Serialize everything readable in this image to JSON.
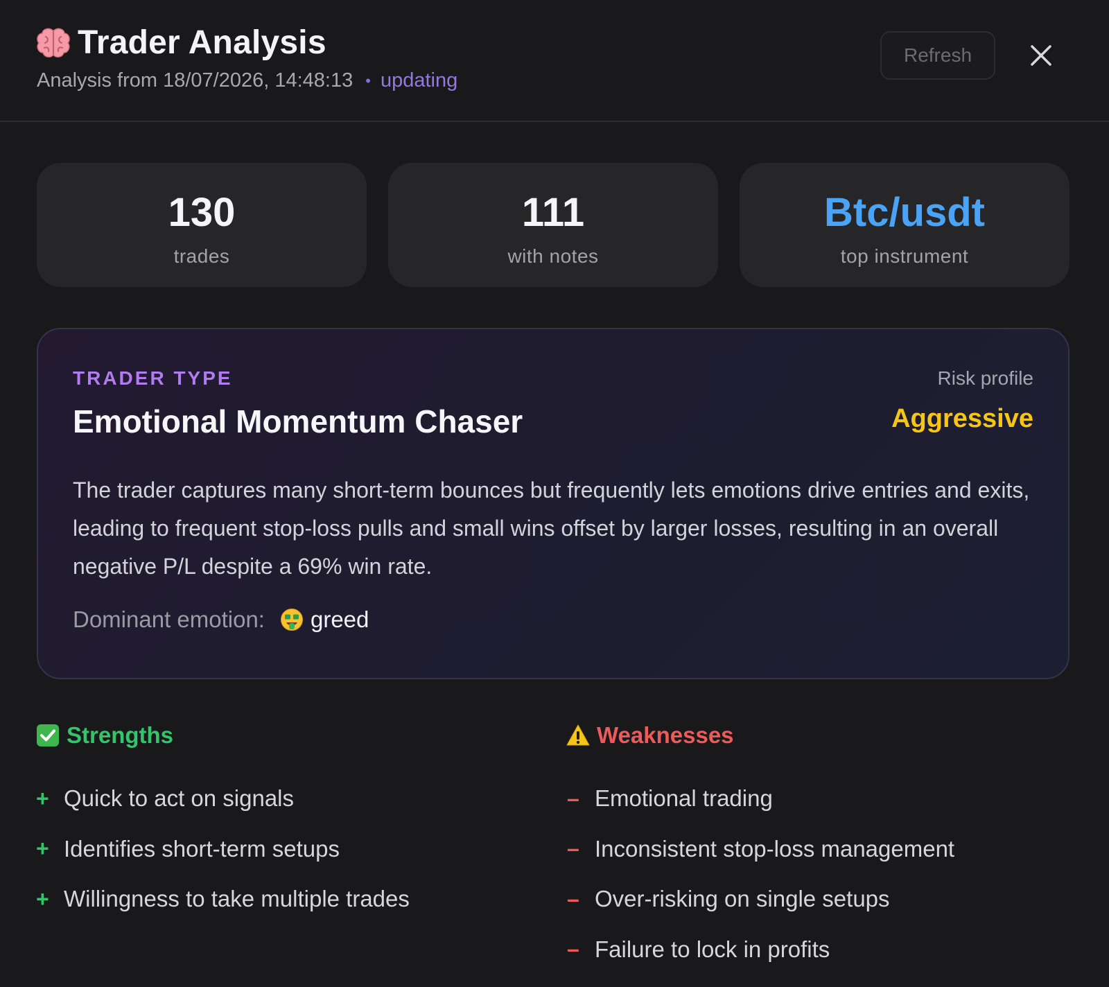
{
  "header": {
    "title": "Trader Analysis",
    "title_icon": "brain-icon",
    "subtitle": "Analysis from 18/07/2026, 14:48:13",
    "dot": "•",
    "status": "updating",
    "refresh_label": "Refresh",
    "close_icon": "close-icon"
  },
  "stats": [
    {
      "value": "130",
      "label": "trades"
    },
    {
      "value": "111",
      "label": "with notes"
    },
    {
      "value": "Btc/usdt",
      "label": "top instrument"
    }
  ],
  "trader_type": {
    "label": "TRADER TYPE",
    "name": "Emotional Momentum Chaser",
    "risk_label": "Risk profile",
    "risk_value": "Aggressive",
    "description": "The trader captures many short-term bounces but frequently lets emotions drive entries and exits, leading to frequent stop-loss pulls and small wins offset by larger losses, resulting in an overall negative P/L despite a 69% win rate.",
    "emotion_label": "Dominant emotion:",
    "emotion_icon": "money-face-icon",
    "emotion_value": "greed"
  },
  "strengths": {
    "title": "Strengths",
    "icon": "check-box-icon",
    "marker": "+",
    "items": [
      "Quick to act on signals",
      "Identifies short-term setups",
      "Willingness to take multiple trades"
    ]
  },
  "weaknesses": {
    "title": "Weaknesses",
    "icon": "warning-icon",
    "marker": "–",
    "items": [
      "Emotional trading",
      "Inconsistent stop-loss management",
      "Over-risking on single setups",
      "Failure to lock in profits"
    ]
  },
  "colors": {
    "background": "#19191b",
    "card": "#262628",
    "accent_blue": "#4aa3f5",
    "accent_purple": "#b07cf0",
    "risk_yellow": "#f5c518",
    "strength_green": "#34c46a",
    "weakness_red": "#ee5a5a"
  }
}
